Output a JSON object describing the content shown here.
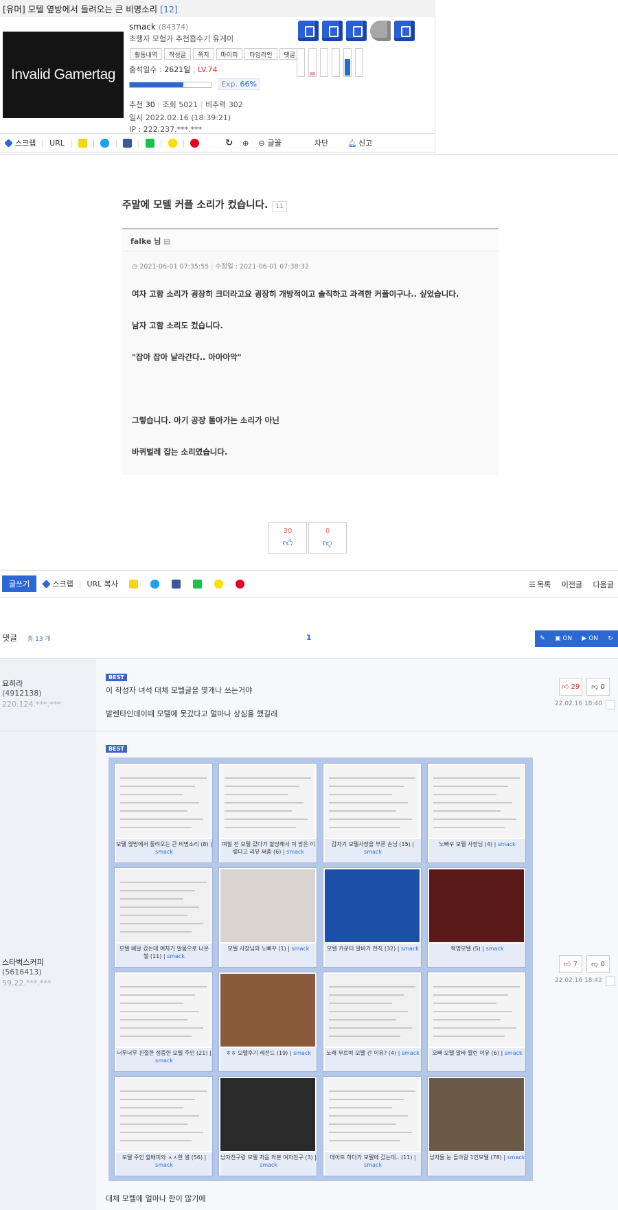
{
  "post": {
    "category": "[유머]",
    "title": "모텔 옆방에서 들려오는 큰 비명소리",
    "comment_count": "[12]"
  },
  "author": {
    "gamertag": "Invalid Gamertag",
    "name": "smack",
    "id": "(84374)",
    "title": "초행자 모험가 추천흡수기 유게이",
    "tabs": [
      "활동내역",
      "작성글",
      "쪽지",
      "마이피",
      "타임라인",
      "댓글"
    ],
    "attendance_label": "출석일수 :",
    "attendance": "2621일",
    "level": "LV.74",
    "exp_label": "Exp.",
    "exp": "66%",
    "exp_fraction": 0.66,
    "stats": {
      "rec_label": "추천",
      "rec": "30",
      "view_label": "조회",
      "view": "5021",
      "nonrec_label": "비추력",
      "nonrec": "302"
    },
    "date": "일시 2022.02.16 (18:39:21)",
    "ip": "IP : 222.237.***.***"
  },
  "sharebar": {
    "scrap": "스크랩",
    "url": "URL",
    "font": "글꼴",
    "block": "차단",
    "report": "신고"
  },
  "article": {
    "heading": "주말에 모텔 커플 소리가 컸습니다.",
    "heading_tag": "11",
    "writer": "falke 님",
    "dates": "2021-06-01 07:35:55",
    "edited": "수정일 : 2021-06-01 07:38:32",
    "paragraphs": [
      "여자 고함 소리가 굉장히 크더라고요 굉장히 개방적이고 솔직하고 과격한 커플이구나.. 싶었습니다.",
      "남자 고함 소리도 컸습니다.",
      "\"잡아 잡아 날라간다.. 아아아악\"",
      "그렇습니다. 아기 공장 돌아가는 소리가 아닌",
      "바퀴벌레 잡는 소리였습니다."
    ]
  },
  "votes": {
    "up": "30",
    "down": "0"
  },
  "actionbar": {
    "write": "글쓰기",
    "scrap": "스크랩",
    "url_copy": "URL 복사",
    "list": "목록",
    "prev": "이전글",
    "next": "다음글"
  },
  "comments_header": {
    "label": "댓글",
    "total_prefix": "총",
    "total": "13",
    "total_suffix": "개",
    "page": "1",
    "img_on": "ON",
    "vid_on": "ON"
  },
  "comments": [
    {
      "name": "요히라",
      "id": "(4912138)",
      "ip": "220.124.***.***",
      "badge": "BEST",
      "lines": [
        "이 작성자 녀석 대체 모텔글을 몇개나 쓰는거야",
        "발렌타인데이때 모텔에 못갔다고 얼마나 상심을 했길래"
      ],
      "up": "29",
      "down": "0",
      "date": "22.02.16 18:40"
    },
    {
      "name": "스타벅스커피",
      "id": "(5616413)",
      "ip": "59.22.***.***",
      "badge": "BEST",
      "caption": "대체 모텔에 얼마나 한이 많기에",
      "up": "7",
      "down": "0",
      "date": "22.02.16 18:42"
    }
  ],
  "gallery": [
    {
      "title": "모텔 옆방에서 들려오는 큰 비명소리 (8)",
      "user": "smack"
    },
    {
      "title": "며칠 전 모텔 갔다가 할당해서 이 방은 이렇다고 리뷰 써줌 (6)",
      "user": "smack"
    },
    {
      "title": "갑자기 모텔사장을 부른 손님 (15)",
      "user": "smack"
    },
    {
      "title": "노빠꾸 모텔 사장님 (4)",
      "user": "smack"
    },
    {
      "title": "모텔 배달 갔는데 여자가 알몸으로 나온 썰 (11)",
      "user": "smack"
    },
    {
      "title": "모텔 사장님의 노빠꾸 (1)",
      "user": "smack"
    },
    {
      "title": "모텔 카운터 알바가 전직 (32)",
      "user": "smack"
    },
    {
      "title": "혁명모텔 (5)",
      "user": "smack"
    },
    {
      "title": "너무너무 친절한 정중한 모텔 주인 (21)",
      "user": "smack"
    },
    {
      "title": "ㅎㅎ 모텔후기 레전드 (19)",
      "user": "smack"
    },
    {
      "title": "노래 부르며 모텔 간 이유? (4)",
      "user": "smack"
    },
    {
      "title": "오빠 모텔 알바 짤린 이유 (6)",
      "user": "smack"
    },
    {
      "title": "모텔 주인 할배미와 ㅅㅅ한 썰 (56)",
      "user": "smack"
    },
    {
      "title": "남자친구랑 모텔 처음 와본 여자친구 (3)",
      "user": "smack"
    },
    {
      "title": "데이트 하다가 모텔에 갔는데.. (11)",
      "user": "smack"
    },
    {
      "title": "남자들 눈 돌아갈 1인모텔 (78)",
      "user": "smack"
    }
  ],
  "colors": {
    "accent": "#2c68d4",
    "red": "#dd3333",
    "best": "#3a64c8",
    "gallery_bg": "#b5c8ea"
  }
}
